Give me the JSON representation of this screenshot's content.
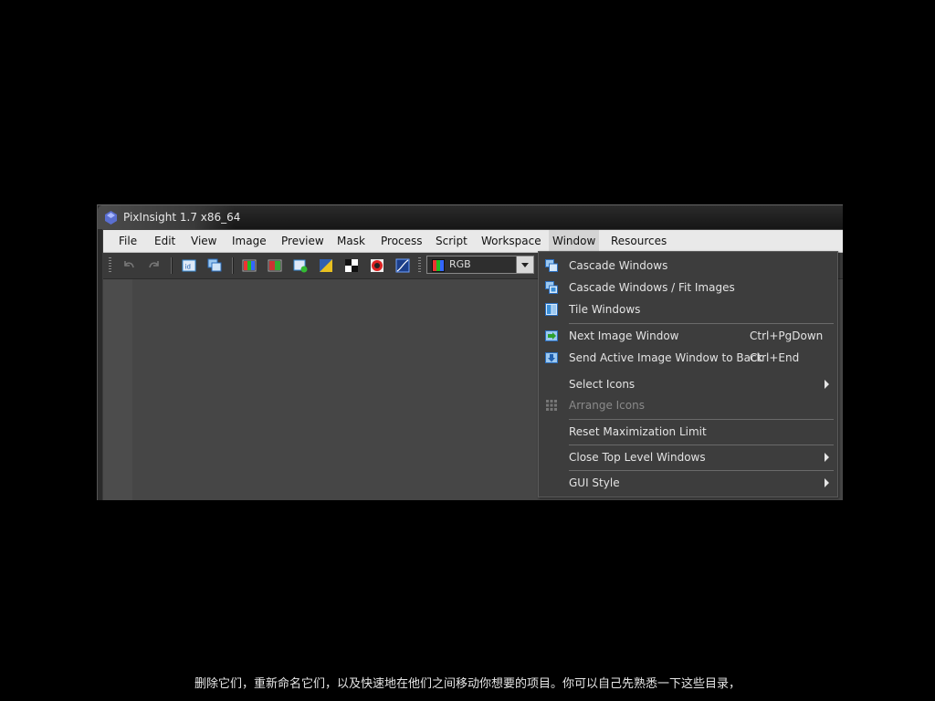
{
  "window": {
    "title": "PixInsight 1.7 x86_64"
  },
  "menubar": {
    "items": [
      {
        "label": "File"
      },
      {
        "label": "Edit"
      },
      {
        "label": "View"
      },
      {
        "label": "Image"
      },
      {
        "label": "Preview"
      },
      {
        "label": "Mask"
      },
      {
        "label": "Process"
      },
      {
        "label": "Script"
      },
      {
        "label": "Workspace"
      },
      {
        "label": "Window"
      },
      {
        "label": "Resources"
      }
    ]
  },
  "toolbar": {
    "color_space": {
      "selected": "RGB"
    }
  },
  "window_menu": {
    "items": [
      {
        "label": "Cascade Windows",
        "icon": "cascade-windows-icon"
      },
      {
        "label": "Cascade Windows / Fit Images",
        "icon": "cascade-fit-icon"
      },
      {
        "label": "Tile Windows",
        "icon": "tile-windows-icon"
      },
      {
        "label": "Next Image Window",
        "shortcut": "Ctrl+PgDown",
        "icon": "next-window-icon"
      },
      {
        "label": "Send Active Image Window to Back",
        "shortcut": "Ctrl+End",
        "icon": "send-back-icon"
      },
      {
        "label": "Select Icons"
      },
      {
        "label": "Arrange Icons",
        "icon": "arrange-icons-icon"
      },
      {
        "label": "Reset Maximization Limit"
      },
      {
        "label": "Close Top Level Windows"
      },
      {
        "label": "GUI Style"
      }
    ]
  },
  "subtitle": {
    "text": "删除它们，重新命名它们，以及快速地在他们之间移动你想要的项目。你可以自己先熟悉一下这些目录，"
  },
  "colors": {
    "accent_icon": "#3a8fd8",
    "menu_bg": "#3d3d3d",
    "menubar_bg": "#e9e9e9"
  }
}
